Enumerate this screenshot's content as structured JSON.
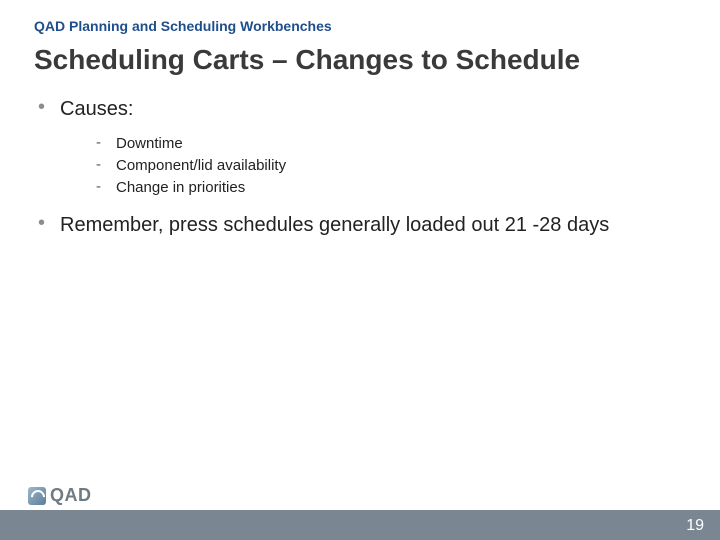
{
  "eyebrow": "QAD Planning and Scheduling Workbenches",
  "title": "Scheduling Carts – Changes to Schedule",
  "bullets": [
    {
      "text": "Causes:",
      "sub": [
        "Downtime",
        "Component/lid availability",
        "Change in priorities"
      ]
    },
    {
      "text": "Remember, press schedules generally loaded out 21 -28 days",
      "sub": []
    }
  ],
  "footer": {
    "logo_text": "QAD",
    "page_number": "19"
  }
}
